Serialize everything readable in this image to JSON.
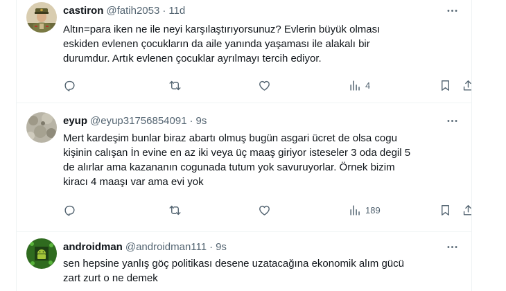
{
  "tweets": [
    {
      "name": "castiron",
      "handle": "@fatih2053",
      "separator": "·",
      "time": "11d",
      "lines": [
        "Altın=para iken ne ile neyi karşılaştırıyorsunuz? Evlerin büyük olması",
        "eskiden evlenen çocukların da aile yanında yaşaması ile alakalı bir",
        "durumdur. Artık evlenen çocuklar ayrılmayı tercih ediyor."
      ],
      "views": "4",
      "avatar_icon": "soldier-avatar"
    },
    {
      "name": "eyup",
      "handle": "@eyup31756854091",
      "separator": "·",
      "time": "9s",
      "lines": [
        "Mert kardeşim bunlar biraz abartı olmuş bugün asgari ücret de olsa cogu",
        "kişinin calışan İn evine en az iki veya üç maaş giriyor isteseler 3 oda degil 5",
        "de alırlar ama kazananın cogunada tutum yok savuruyorlar. Örnek bizim",
        "kiracı 4 maaşı var ama evi yok"
      ],
      "views": "189",
      "avatar_icon": "stone-texture-avatar"
    },
    {
      "name": "androidman",
      "handle": "@androidman111",
      "separator": "·",
      "time": "9s",
      "lines": [
        "sen hepsine yanlış göç politikası desene uzatacağına ekonomik alım gücü",
        "zart zurt o ne demek"
      ],
      "avatar_icon": "android-avatar"
    }
  ],
  "colors": {
    "text": "#0f1419",
    "secondary": "#536471",
    "border": "#eff3f4"
  },
  "icons": [
    "reply-icon",
    "retweet-icon",
    "like-icon",
    "views-icon",
    "bookmark-icon",
    "share-icon",
    "more-icon"
  ]
}
